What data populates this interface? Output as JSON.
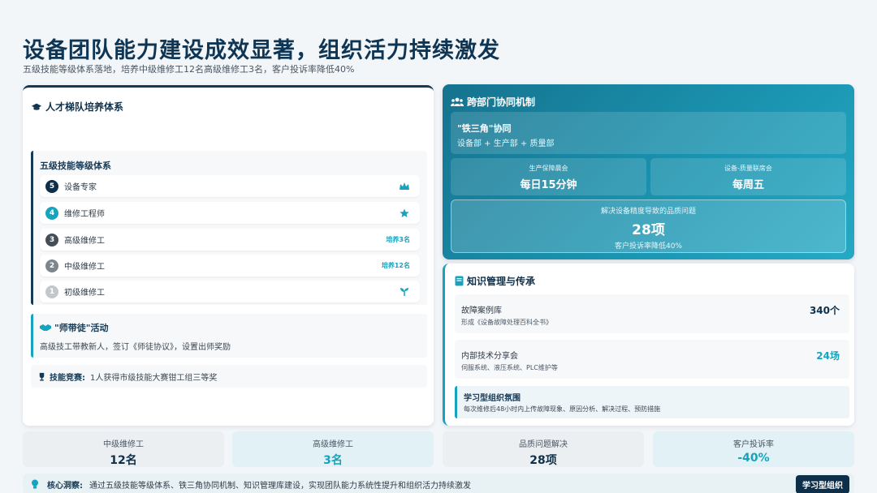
{
  "header": {
    "title": "设备团队能力建设成效显著，组织活力持续激发",
    "subtitle": "五级技能等级体系落地，培养中级维修工12名高级维修工3名，客户投诉率降低40%"
  },
  "left": {
    "title": "人才梯队培养体系",
    "levels_title": "五级技能等级体系",
    "levels": [
      {
        "num": "5",
        "name": "设备专家",
        "right": "",
        "icon": "crown-icon"
      },
      {
        "num": "4",
        "name": "维修工程师",
        "right": "",
        "icon": "star-icon"
      },
      {
        "num": "3",
        "name": "高级维修工",
        "right": "培养3名",
        "icon": ""
      },
      {
        "num": "2",
        "name": "中级维修工",
        "right": "培养12名",
        "icon": ""
      },
      {
        "num": "1",
        "name": "初级维修工",
        "right": "",
        "icon": "seedling-icon"
      }
    ],
    "mentor_title": "\"师带徒\"活动",
    "mentor_text": "高级技工带教新人，签订《师徒协议》，设置出师奖励",
    "contest_label": "技能竞赛:",
    "contest_text": "1人获得市级技能大赛钳工组三等奖"
  },
  "collab": {
    "title": "跨部门协同机制",
    "tri_title": "\"铁三角\"协同",
    "tri_sub": "设备部 + 生产部 + 质量部",
    "meetings": [
      {
        "label": "生产保障晨会",
        "value": "每日15分钟"
      },
      {
        "label": "设备-质量联席会",
        "value": "每周五"
      }
    ],
    "quality_label": "解决设备精度导致的品质问题",
    "quality_value": "28项",
    "quality_sub": "客户投诉率降低40%"
  },
  "knowledge": {
    "title": "知识管理与传承",
    "rows": [
      {
        "title": "故障案例库",
        "sub": "形成《设备故障处理百科全书》",
        "value": "340个"
      },
      {
        "title": "内部技术分享会",
        "sub": "伺服系统、液压系统、PLC维护等",
        "value": "24场"
      }
    ],
    "learn_title": "学习型组织氛围",
    "learn_text": "每次维修后48小时内上传故障现象、原因分析、解决过程、预防措施"
  },
  "stats": [
    {
      "label": "中级维修工",
      "value": "12名"
    },
    {
      "label": "高级维修工",
      "value": "3名"
    },
    {
      "label": "品质问题解决",
      "value": "28项"
    },
    {
      "label": "客户投诉率",
      "value": "-40%"
    }
  ],
  "insight": {
    "label": "核心洞察:",
    "text": "通过五级技能等级体系、铁三角协同机制、知识管理库建设，实现团队能力系统性提升和组织活力持续激发",
    "badge": "学习型组织"
  },
  "colors": {
    "navy": "#163a56",
    "teal": "#17a3bd",
    "accent_dark": "#0e2f4a"
  }
}
